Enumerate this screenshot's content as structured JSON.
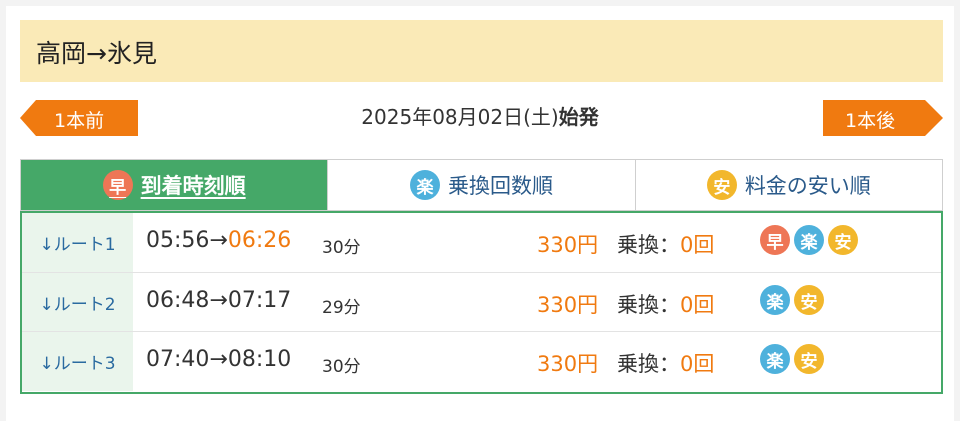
{
  "header": {
    "title": "高岡→氷見"
  },
  "date_bar": {
    "date": "2025年08月02日(土)",
    "first_label": "始発",
    "prev_label": "1本前",
    "next_label": "1本後"
  },
  "tabs": [
    {
      "label": "到着時刻順",
      "badge": "早",
      "active": true
    },
    {
      "label": "乗換回数順",
      "badge": "楽",
      "active": false
    },
    {
      "label": "料金の安い順",
      "badge": "安",
      "active": false
    }
  ],
  "routes": [
    {
      "label": "↓ルート1",
      "depart": "05:56",
      "arrow": "→",
      "arrive": "06:26",
      "duration": "30分",
      "fare": "330円",
      "transfer_label": "乗換：",
      "transfer_count": "0回",
      "badges": [
        "早",
        "楽",
        "安"
      ]
    },
    {
      "label": "↓ルート2",
      "depart": "06:48",
      "arrow": "→",
      "arrive": "07:17",
      "duration": "29分",
      "fare": "330円",
      "transfer_label": "乗換：",
      "transfer_count": "0回",
      "badges": [
        "楽",
        "安"
      ]
    },
    {
      "label": "↓ルート3",
      "depart": "07:40",
      "arrow": "→",
      "arrive": "08:10",
      "duration": "30分",
      "fare": "330円",
      "transfer_label": "乗換：",
      "transfer_count": "0回",
      "badges": [
        "楽",
        "安"
      ]
    }
  ],
  "colors": {
    "accent_green": "#45a868",
    "accent_orange": "#f07a10",
    "badge_early": "#ee7656",
    "badge_easy": "#4eb1dc",
    "badge_cheap": "#f2b72c"
  }
}
